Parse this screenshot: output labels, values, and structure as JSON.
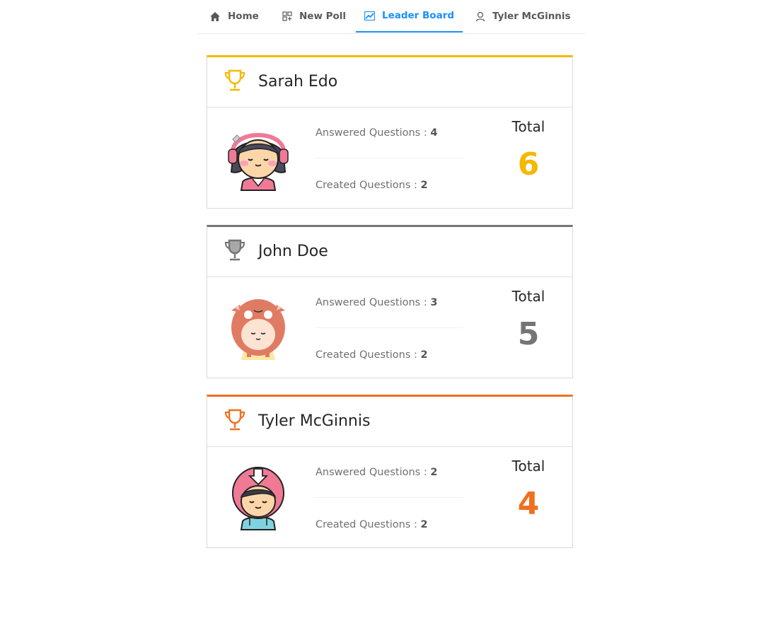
{
  "nav": {
    "items": [
      {
        "label": "Home",
        "icon": "home-icon"
      },
      {
        "label": "New Poll",
        "icon": "new-poll-icon"
      },
      {
        "label": "Leader Board",
        "icon": "line-chart-icon",
        "active": true
      },
      {
        "label": "Tyler McGinnis",
        "icon": "user-icon"
      }
    ],
    "active_color": "#1890ff"
  },
  "leaderboard": [
    {
      "name": "Sarah Edo",
      "answered_label": "Answered Questions : ",
      "answered": "4",
      "created_label": "Created Questions : ",
      "created": "2",
      "total_label": "Total",
      "total": "6",
      "accent": "#f5b800",
      "trophy": "trophy-gold-icon",
      "avatar": "girl-headphones-avatar"
    },
    {
      "name": "John Doe",
      "answered_label": "Answered Questions : ",
      "answered": "3",
      "created_label": "Created Questions : ",
      "created": "2",
      "total_label": "Total",
      "total": "5",
      "accent": "#757575",
      "trophy": "trophy-silver-icon",
      "avatar": "cow-costume-avatar"
    },
    {
      "name": "Tyler McGinnis",
      "answered_label": "Answered Questions : ",
      "answered": "2",
      "created_label": "Created Questions : ",
      "created": "2",
      "total_label": "Total",
      "total": "4",
      "accent": "#f07020",
      "trophy": "trophy-bronze-icon",
      "avatar": "boy-download-hood-avatar"
    }
  ]
}
